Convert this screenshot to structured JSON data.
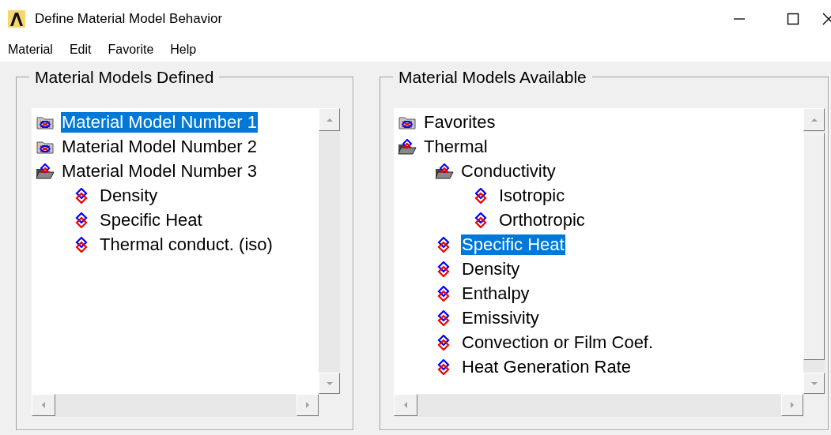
{
  "window": {
    "title": "Define Material Model Behavior"
  },
  "menu": [
    "Material",
    "Edit",
    "Favorite",
    "Help"
  ],
  "panels": [
    {
      "title": "Material Models Defined",
      "tree": [
        {
          "kind": "closed-folder",
          "label": "Material Model Number 1",
          "selected": true
        },
        {
          "kind": "closed-folder",
          "label": "Material Model Number 2",
          "selected": false
        },
        {
          "kind": "open-folder",
          "label": "Material Model Number 3",
          "selected": false,
          "children": [
            {
              "kind": "item",
              "label": "Density",
              "selected": false
            },
            {
              "kind": "item",
              "label": "Specific Heat",
              "selected": false
            },
            {
              "kind": "item",
              "label": "Thermal conduct. (iso)",
              "selected": false
            }
          ]
        }
      ]
    },
    {
      "title": "Material Models Available",
      "tree": [
        {
          "kind": "closed-folder",
          "label": "Favorites",
          "selected": false
        },
        {
          "kind": "open-folder",
          "label": "Thermal",
          "selected": false,
          "children": [
            {
              "kind": "open-folder",
              "label": "Conductivity",
              "selected": false,
              "children": [
                {
                  "kind": "item",
                  "label": "Isotropic",
                  "selected": false
                },
                {
                  "kind": "item",
                  "label": "Orthotropic",
                  "selected": false
                }
              ]
            },
            {
              "kind": "item",
              "label": "Specific Heat",
              "selected": true
            },
            {
              "kind": "item",
              "label": "Density",
              "selected": false
            },
            {
              "kind": "item",
              "label": "Enthalpy",
              "selected": false
            },
            {
              "kind": "item",
              "label": "Emissivity",
              "selected": false
            },
            {
              "kind": "item",
              "label": "Convection or Film Coef.",
              "selected": false
            },
            {
              "kind": "item",
              "label": "Heat Generation Rate",
              "selected": false
            }
          ]
        }
      ]
    }
  ]
}
